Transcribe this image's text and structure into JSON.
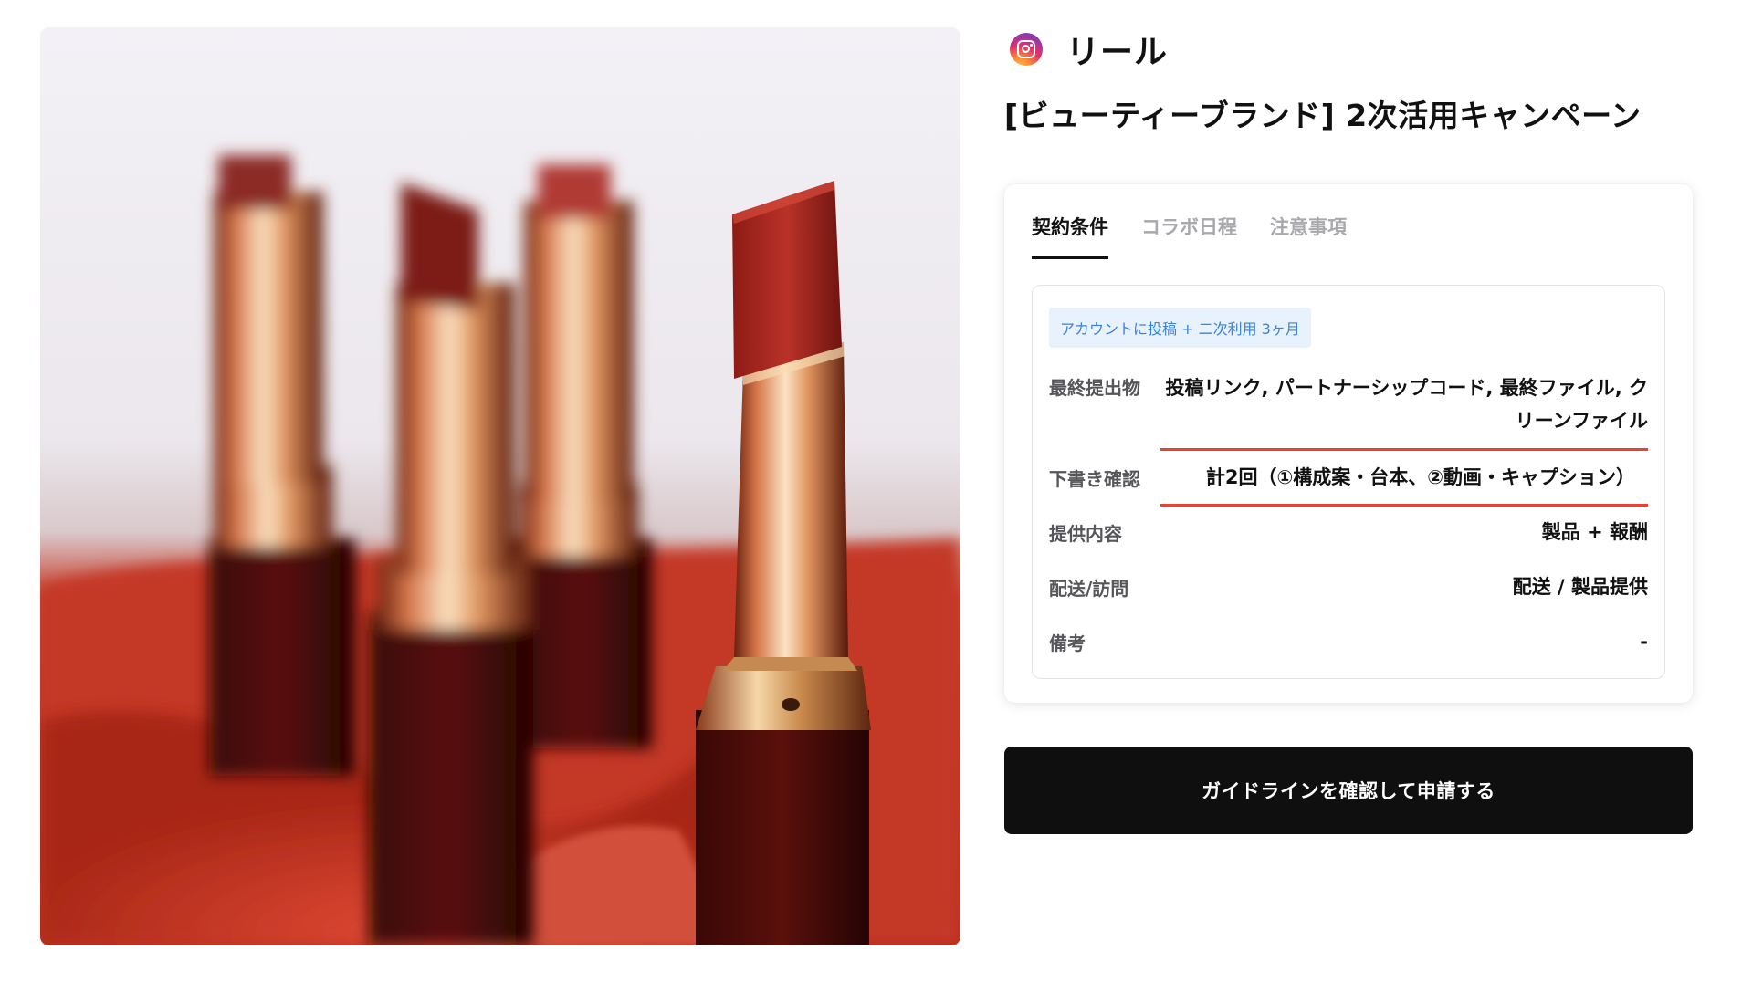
{
  "product_image": {
    "alt_icon": "lipstick-photo"
  },
  "platform": {
    "icon": "instagram-icon",
    "label": "リール"
  },
  "campaign": {
    "title": "[ビューティーブランド] 2次活用キャンペーン"
  },
  "tabs": [
    {
      "label": "契約条件",
      "active": true
    },
    {
      "label": "コラボ日程",
      "active": false
    },
    {
      "label": "注意事項",
      "active": false
    }
  ],
  "terms": {
    "badge": "アカウントに投稿 + 二次利用 3ヶ月",
    "rows": [
      {
        "label": "最終提出物",
        "value": "投稿リンク, パートナーシップコード, 最終ファイル, クリーンファイル"
      },
      {
        "label": "下書き確認",
        "value": "計2回（①構成案・台本、②動画・キャプション）"
      },
      {
        "label": "提供内容",
        "value": "製品 + 報酬"
      },
      {
        "label": "配送/訪問",
        "value": "配送 / 製品提供"
      },
      {
        "label": "備考",
        "value": "-"
      }
    ]
  },
  "apply_button": {
    "label": "ガイドラインを確認して申請する"
  },
  "colors": {
    "accent_underline": "#e8432b",
    "badge_bg": "#e8f2fc",
    "badge_text": "#3b82d9",
    "button_bg": "#0f0f10"
  }
}
